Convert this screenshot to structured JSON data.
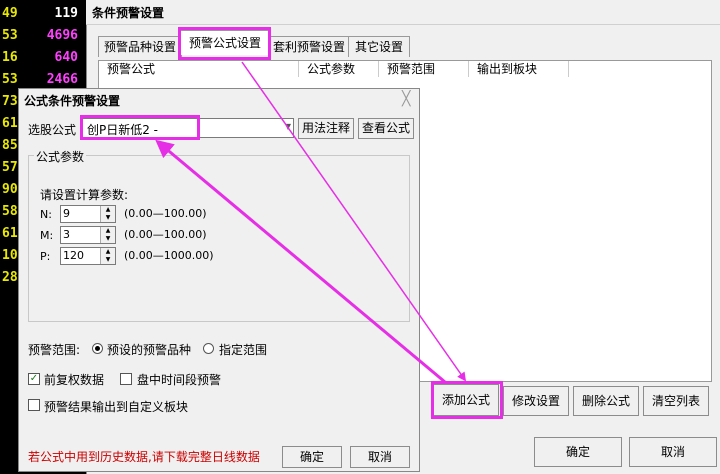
{
  "strip": [
    {
      "a": "49",
      "b": "119",
      "bc": "w"
    },
    {
      "a": "53",
      "b": "4696",
      "bc": "p"
    },
    {
      "a": "16",
      "b": "640",
      "bc": "p"
    },
    {
      "a": "53",
      "b": "2466",
      "bc": "p"
    },
    {
      "a": "73",
      "b": "",
      "bc": "p"
    },
    {
      "a": "61",
      "b": "",
      "bc": "p"
    },
    {
      "a": "85",
      "b": "",
      "bc": "p"
    },
    {
      "a": "57",
      "b": "",
      "bc": "p"
    },
    {
      "a": "90",
      "b": "",
      "bc": "p"
    },
    {
      "a": "58",
      "b": "",
      "bc": "p"
    },
    {
      "a": "61",
      "b": "",
      "bc": "p"
    },
    {
      "a": "10",
      "b": "",
      "bc": "p"
    },
    {
      "a": "28",
      "b": "",
      "bc": "p"
    }
  ],
  "main": {
    "title": "条件预警设置",
    "tabs": [
      "预警品种设置",
      "预警公式设置",
      "套利预警设置",
      "其它设置"
    ],
    "columns": [
      "预警公式",
      "公式参数",
      "预警范围",
      "输出到板块"
    ],
    "buttons": {
      "add": "添加公式",
      "edit": "修改设置",
      "delete": "删除公式",
      "clear": "清空列表",
      "ok": "确定",
      "cancel": "取消"
    }
  },
  "inner": {
    "title": "公式条件预警设置",
    "close": "╳",
    "formula_label": "选股公式",
    "formula_value": "创P日新低2    -",
    "usage_btn": "用法注释",
    "view_btn": "查看公式",
    "group_title": "公式参数",
    "prompt": "请设置计算参数:",
    "params": [
      {
        "name": "N:",
        "value": "9",
        "range": "(0.00—100.00)"
      },
      {
        "name": "M:",
        "value": "3",
        "range": "(0.00—100.00)"
      },
      {
        "name": "P:",
        "value": "120",
        "range": "(0.00—1000.00)"
      }
    ],
    "scope_label": "预警范围:",
    "scope_opt1": "预设的预警品种",
    "scope_opt2": "指定范围",
    "cb1": "前复权数据",
    "cb2": "盘中时间段预警",
    "cb3": "预警结果输出到自定义板块",
    "warning": "若公式中用到历史数据,请下载完整日线数据",
    "ok": "确定",
    "cancel": "取消",
    "check_mark": "✓",
    "spin_up": "▲",
    "spin_down": "▼",
    "combo_arrow": "▼"
  }
}
